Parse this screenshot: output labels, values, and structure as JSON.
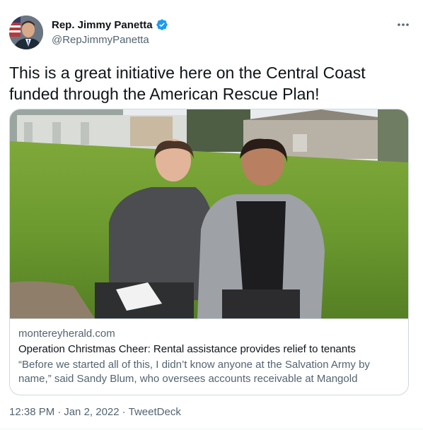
{
  "author": {
    "display_name": "Rep. Jimmy Panetta",
    "handle": "@RepJimmyPanetta",
    "verified": true
  },
  "tweet": {
    "text": "This is a great initiative here on the Central Coast funded through the American Rescue Plan!"
  },
  "card": {
    "domain": "montereyherald.com",
    "title": "Operation Christmas Cheer: Rental assistance provides relief to tenants",
    "description": "“Before we started all of this, I didn’t know anyone at the Salvation Army by name,” said Sandy Blum, who oversees accounts receivable at Mangold Proper…"
  },
  "meta": {
    "time": "12:38 PM",
    "separator": "·",
    "date": "Jan 2, 2022",
    "source": "TweetDeck"
  },
  "colors": {
    "accent": "#1d9bf0",
    "text_primary": "#0f1419",
    "text_secondary": "#536471",
    "border": "#cfd9de"
  },
  "icons": {
    "verified": "verified-badge-icon",
    "more": "more-horizontal-icon"
  }
}
